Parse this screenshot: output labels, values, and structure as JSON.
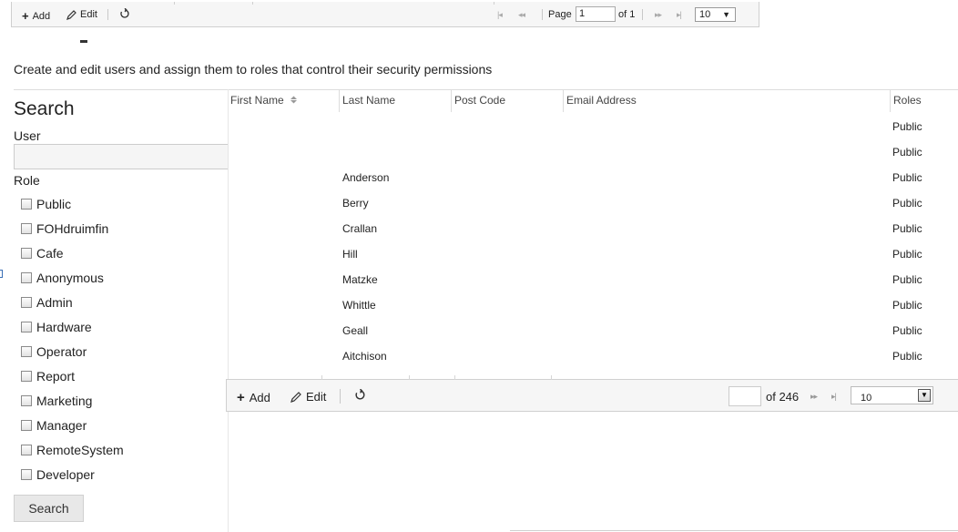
{
  "top_toolbar": {
    "add_label": "Add",
    "edit_label": "Edit",
    "refresh_icon": "refresh-icon",
    "page_label": "Page",
    "page_value": "1",
    "of_label": "of 1",
    "page_size": "10",
    "nav_first": "|◂",
    "nav_prev": "◂◂",
    "nav_next": "▸▸",
    "nav_last": "▸|"
  },
  "page": {
    "description": "Create and edit users and assign them to roles that control their security permissions"
  },
  "search_panel": {
    "title": "Search",
    "user_label": "User",
    "user_value": "",
    "role_label": "Role",
    "roles": [
      "Public",
      "FOHdruimfin",
      "Cafe",
      "Anonymous",
      "Admin",
      "Hardware",
      "Operator",
      "Report",
      "Marketing",
      "Manager",
      "RemoteSystem",
      "Developer"
    ],
    "search_button": "Search"
  },
  "grid": {
    "columns": {
      "first_name": "First Name",
      "last_name": "Last Name",
      "post_code": "Post Code",
      "email": "Email Address",
      "roles": "Roles"
    },
    "sort_icon": "sort-asc-desc-icon",
    "rows": [
      {
        "first_name": "",
        "last_name": "",
        "post_code": "",
        "email": "",
        "roles": "Public"
      },
      {
        "first_name": "",
        "last_name": "",
        "post_code": "",
        "email": "",
        "roles": "Public"
      },
      {
        "first_name": "",
        "last_name": "Anderson",
        "post_code": "",
        "email": "",
        "roles": "Public"
      },
      {
        "first_name": "",
        "last_name": "Berry",
        "post_code": "",
        "email": "",
        "roles": "Public"
      },
      {
        "first_name": "",
        "last_name": "Crallan",
        "post_code": "",
        "email": "",
        "roles": "Public"
      },
      {
        "first_name": "",
        "last_name": "Hill",
        "post_code": "",
        "email": "",
        "roles": "Public"
      },
      {
        "first_name": "",
        "last_name": "Matzke",
        "post_code": "",
        "email": "",
        "roles": "Public"
      },
      {
        "first_name": "",
        "last_name": "Whittle",
        "post_code": "",
        "email": "",
        "roles": "Public"
      },
      {
        "first_name": "",
        "last_name": "Geall",
        "post_code": "",
        "email": "",
        "roles": "Public"
      },
      {
        "first_name": "",
        "last_name": "Aitchison",
        "post_code": "",
        "email": "",
        "roles": "Public"
      }
    ]
  },
  "grid_toolbar": {
    "add_label": "Add",
    "edit_label": "Edit",
    "refresh_icon": "refresh-icon",
    "page_value": "",
    "of_label": "of 246",
    "page_size": "10",
    "nav_next": "▸▸",
    "nav_last": "▸|"
  }
}
